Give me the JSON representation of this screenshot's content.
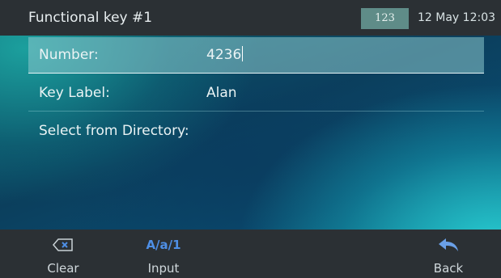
{
  "header": {
    "title": "Functional key #1",
    "mode_badge": "123",
    "datetime": "12 May 12:03"
  },
  "form": {
    "number": {
      "label": "Number:",
      "value": "4236"
    },
    "key_label": {
      "label": "Key Label:",
      "value": "Alan"
    },
    "directory": {
      "label": "Select from Directory:"
    }
  },
  "softkeys": {
    "clear": {
      "label": "Clear",
      "icon": "backspace-clear-icon"
    },
    "input": {
      "label": "Input",
      "icon_text": "A/a/1"
    },
    "back": {
      "label": "Back",
      "icon": "back-arrow-icon"
    }
  },
  "colors": {
    "bar_background": "#2b3034",
    "badge_background": "#5f8c88",
    "input_mode_icon": "#4e8fe6"
  }
}
